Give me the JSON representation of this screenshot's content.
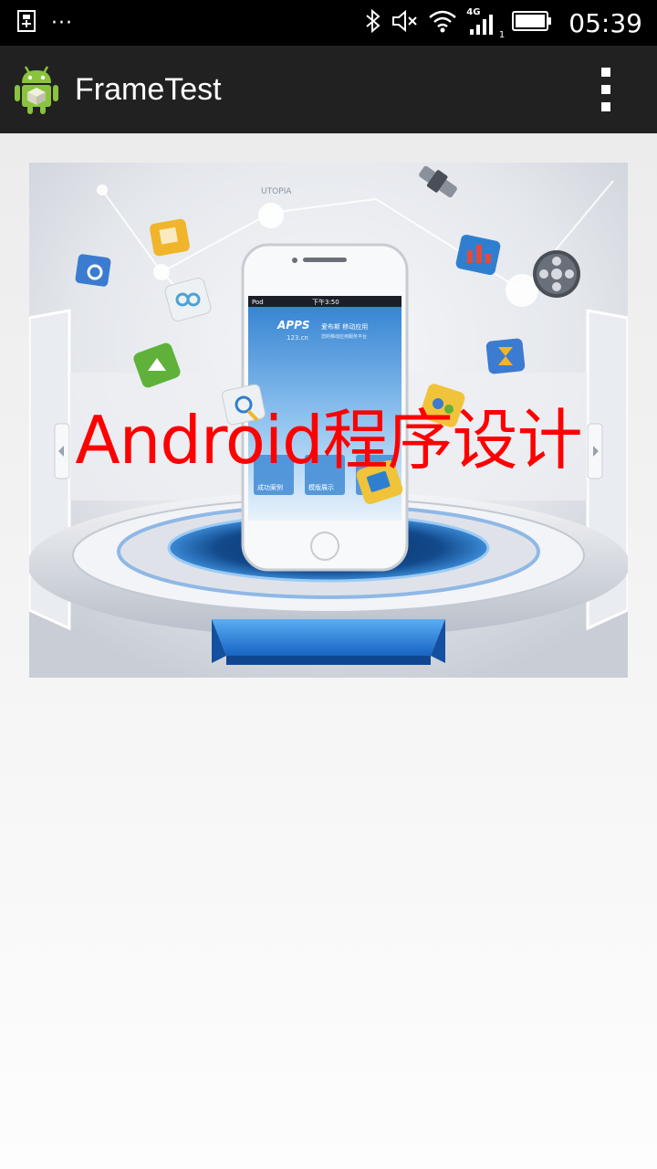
{
  "status_bar": {
    "time": "05:39",
    "more_indicator": "···",
    "network": "4G",
    "sim_slot": "1",
    "icons": [
      "usb-icon",
      "bluetooth-icon",
      "mute-icon",
      "wifi-icon",
      "signal-icon",
      "battery-icon"
    ]
  },
  "action_bar": {
    "title": "FrameTest",
    "app_icon": "android-icon",
    "menu_icon": "overflow-menu-icon"
  },
  "frame": {
    "overlay_text": "Android程序设计",
    "overlay_color": "#ff0000",
    "image": {
      "phone_status": "Pod",
      "phone_time": "下午3:50",
      "banner_brand": "APPS",
      "banner_sub": "123.cn",
      "banner_line1": "爱布斯 移动应用",
      "banner_line2": "您的移动应用服务平台",
      "tile1": "成功案例",
      "tile2": "模版展示",
      "footer": "UTOPIA"
    }
  }
}
